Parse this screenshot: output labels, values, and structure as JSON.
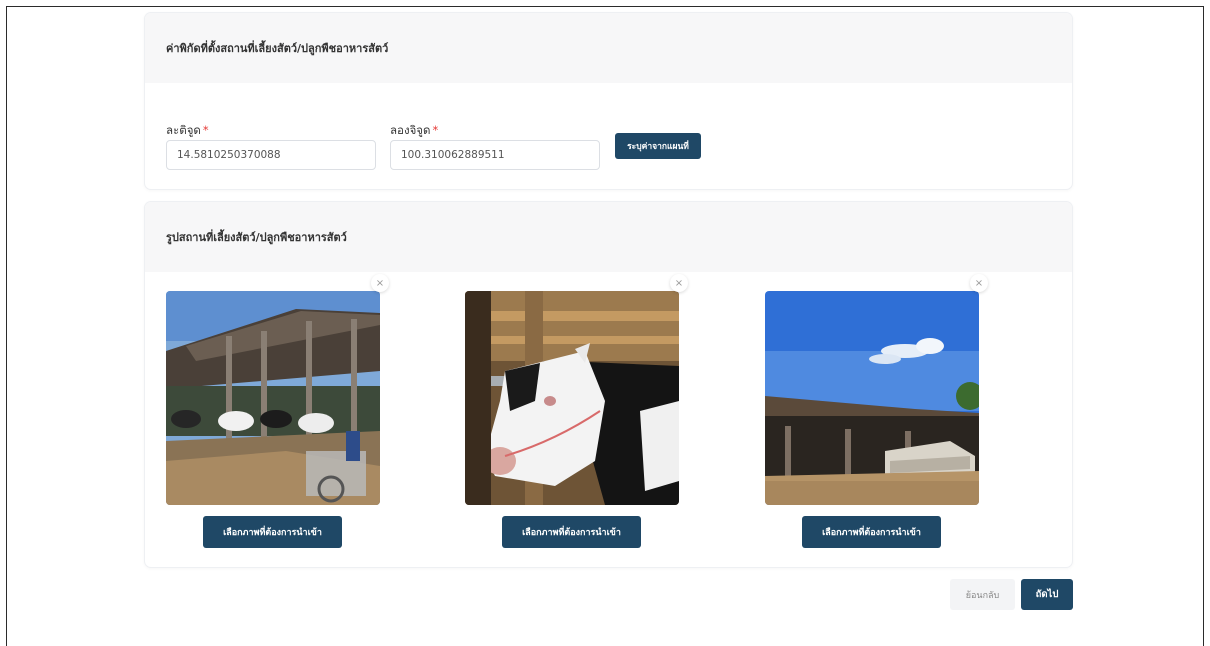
{
  "coords_section": {
    "title": "ค่าพิกัดที่ตั้งสถานที่เลี้ยงสัตว์/ปลูกพืชอาหารสัตว์",
    "latitude": {
      "label": "ละติจูด",
      "value": "14.5810250370088"
    },
    "longitude": {
      "label": "ลองจิจูด",
      "value": "100.310062889511"
    },
    "map_button_label": "ระบุค่าจากแผนที่"
  },
  "photos_section": {
    "title": "รูปสถานที่เลี้ยงสัตว์/ปลูกพืชอาหารสัตว์",
    "photos": [
      {
        "icon": "barn-photo",
        "choose_label": "เลือกภาพที่ต้องการนำเข้า",
        "close_label": "×"
      },
      {
        "icon": "cow-photo",
        "choose_label": "เลือกภาพที่ต้องการนำเข้า",
        "close_label": "×"
      },
      {
        "icon": "shed-photo",
        "choose_label": "เลือกภาพที่ต้องการนำเข้า",
        "close_label": "×"
      }
    ]
  },
  "footer": {
    "back_label": "ย้อนกลับ",
    "next_label": "ถัดไป"
  },
  "colors": {
    "primary": "#1f4866",
    "required": "#e53935",
    "header_bg": "#f7f7f8"
  }
}
